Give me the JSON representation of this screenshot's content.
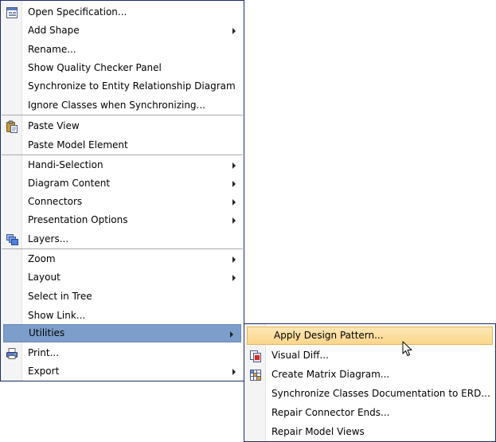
{
  "main_menu": {
    "items": [
      {
        "label": "Open Specification...",
        "icon": "specification-icon",
        "submenu": false
      },
      {
        "label": "Add Shape",
        "submenu": true
      },
      {
        "label": "Rename...",
        "submenu": false
      },
      {
        "label": "Show Quality Checker Panel",
        "submenu": false
      },
      {
        "label": "Synchronize to Entity Relationship Diagram",
        "submenu": false
      },
      {
        "label": "Ignore Classes when Synchronizing...",
        "submenu": false
      },
      {
        "label": "Paste View",
        "icon": "clipboard-paste-icon",
        "submenu": false
      },
      {
        "label": "Paste Model Element",
        "submenu": false
      },
      {
        "label": "Handi-Selection",
        "submenu": true
      },
      {
        "label": "Diagram Content",
        "submenu": true
      },
      {
        "label": "Connectors",
        "submenu": true
      },
      {
        "label": "Presentation Options",
        "submenu": true
      },
      {
        "label": "Layers...",
        "icon": "layers-icon",
        "submenu": false
      },
      {
        "label": "Zoom",
        "submenu": true
      },
      {
        "label": "Layout",
        "submenu": true
      },
      {
        "label": "Select in Tree",
        "submenu": false
      },
      {
        "label": "Show Link...",
        "submenu": false
      },
      {
        "label": "Utilities",
        "submenu": true,
        "state": "active"
      },
      {
        "label": "Print...",
        "icon": "printer-icon",
        "submenu": false
      },
      {
        "label": "Export",
        "submenu": true
      }
    ]
  },
  "utilities_submenu": {
    "items": [
      {
        "label": "Apply Design Pattern...",
        "state": "hover"
      },
      {
        "label": "Visual Diff...",
        "icon": "visual-diff-icon"
      },
      {
        "label": "Create Matrix Diagram...",
        "icon": "matrix-diagram-icon"
      },
      {
        "label": "Synchronize Classes Documentation to ERD..."
      },
      {
        "label": "Repair Connector Ends..."
      },
      {
        "label": "Repair Model Views"
      }
    ]
  },
  "colors": {
    "menu_border": "#1c2a6e",
    "active_item": "#7d9ecb",
    "hover_item": "#fbd68c"
  }
}
